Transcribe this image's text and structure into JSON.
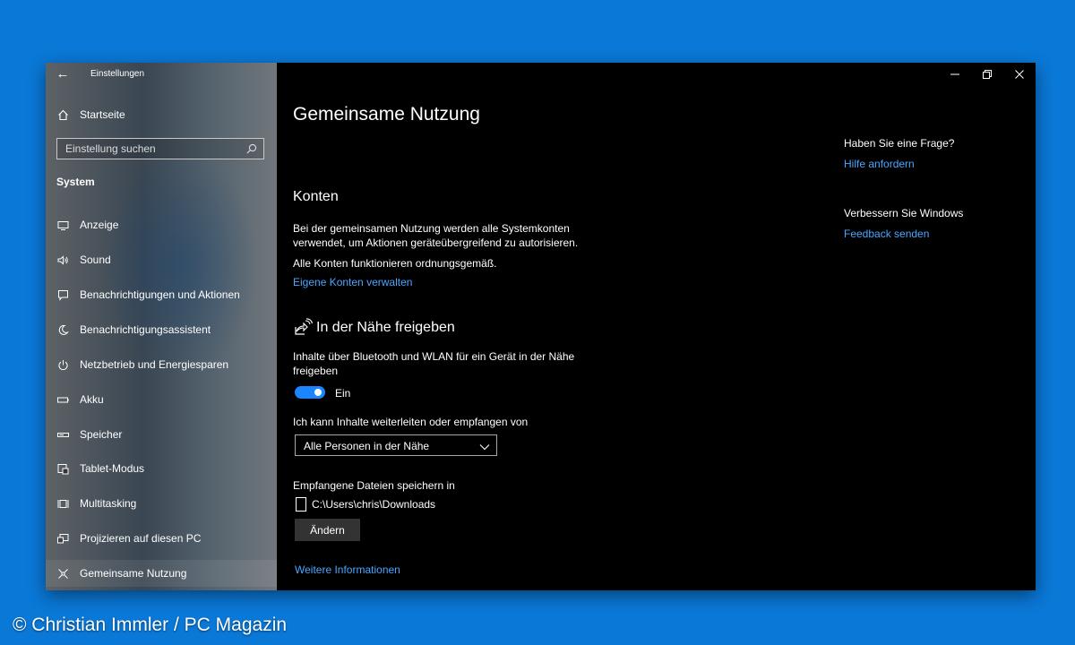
{
  "window": {
    "title": "Einstellungen"
  },
  "sidebar": {
    "home_label": "Startseite",
    "search_placeholder": "Einstellung suchen",
    "section_label": "System",
    "items": [
      {
        "label": "Anzeige",
        "icon": "monitor-icon"
      },
      {
        "label": "Sound",
        "icon": "speaker-icon"
      },
      {
        "label": "Benachrichtigungen und Aktionen",
        "icon": "notification-icon"
      },
      {
        "label": "Benachrichtigungsassistent",
        "icon": "moon-icon"
      },
      {
        "label": "Netzbetrieb und Energiesparen",
        "icon": "power-icon"
      },
      {
        "label": "Akku",
        "icon": "battery-icon"
      },
      {
        "label": "Speicher",
        "icon": "storage-icon"
      },
      {
        "label": "Tablet-Modus",
        "icon": "tablet-mode-icon"
      },
      {
        "label": "Multitasking",
        "icon": "multitasking-icon"
      },
      {
        "label": "Projizieren auf diesen PC",
        "icon": "project-icon"
      },
      {
        "label": "Gemeinsame Nutzung",
        "icon": "shared-experiences-icon",
        "selected": true
      }
    ]
  },
  "main": {
    "page_title": "Gemeinsame Nutzung",
    "accounts": {
      "heading": "Konten",
      "description_line1": "Bei der gemeinsamen Nutzung werden alle Systemkonten",
      "description_line2": "verwendet, um Aktionen geräteübergreifend zu autorisieren.",
      "status": "Alle Konten funktionieren ordnungsgemäß.",
      "manage_link": "Eigene Konten verwalten"
    },
    "nearby": {
      "heading": "In der Nähe freigeben",
      "description_line1": "Inhalte über Bluetooth und WLAN für ein Gerät in der Nähe",
      "description_line2": "freigeben",
      "toggle_state": "Ein",
      "share_from_label": "Ich kann Inhalte weiterleiten oder empfangen von",
      "share_from_value": "Alle Personen in der Nähe",
      "save_to_label": "Empfangene Dateien speichern in",
      "save_path": "C:\\Users\\chris\\Downloads",
      "change_button": "Ändern",
      "more_info_link": "Weitere Informationen"
    },
    "help": {
      "question_heading": "Haben Sie eine Frage?",
      "help_link": "Hilfe anfordern",
      "improve_heading": "Verbessern Sie Windows",
      "feedback_link": "Feedback senden"
    }
  },
  "overlay": {
    "copyright": "© Christian Immler / PC Magazin"
  },
  "colors": {
    "accent": "#1a85ff",
    "link": "#4aa6ff",
    "desktop": "#0a78d7"
  }
}
